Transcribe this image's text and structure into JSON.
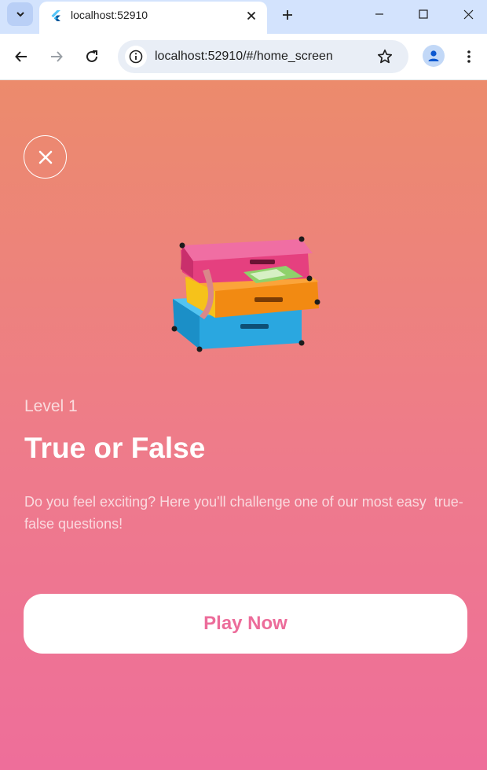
{
  "browser": {
    "tab_title": "localhost:52910",
    "url": "localhost:52910/#/home_screen"
  },
  "colors": {
    "gradient_top": "#ec8b6c",
    "gradient_bottom": "#ee6e9a",
    "accent": "#ec6c9a"
  },
  "icons": {
    "tab_search": "chevron-down-icon",
    "favicon": "flutter-logo-icon",
    "tab_close": "close-icon",
    "new_tab": "plus-icon",
    "back": "arrow-left-icon",
    "forward": "arrow-right-icon",
    "reload": "reload-icon",
    "site_info": "info-icon",
    "bookmark": "star-icon",
    "profile": "person-icon",
    "menu": "more-vertical-icon",
    "app_close": "close-icon",
    "illustration": "stacked-suitcases-illustration"
  },
  "screen": {
    "level": "Level 1",
    "title": "True or False",
    "description": "Do you feel exciting? Here you'll challenge one of our most easy  true-false questions!",
    "play_label": "Play Now"
  }
}
